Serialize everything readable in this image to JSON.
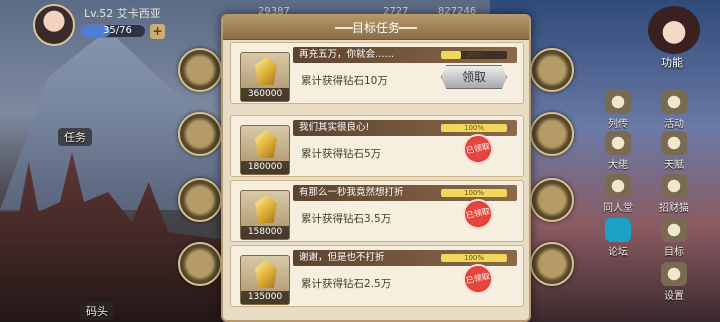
{
  "player": {
    "level": "Lv.52",
    "name": "艾卡西亚",
    "energy": "35/76",
    "energy_fraction": 0.46,
    "plus": "+"
  },
  "resources": {
    "gold": "29387",
    "diamond": "2727",
    "coin": "827246"
  },
  "left_tags": {
    "task": "任务",
    "port": "码头"
  },
  "right_menu": {
    "function": "功能",
    "items": [
      {
        "label": "列传",
        "icon": "book-icon"
      },
      {
        "label": "活动",
        "icon": "event-icon"
      },
      {
        "label": "大佬",
        "icon": "boss-icon"
      },
      {
        "label": "天赋",
        "icon": "talent-icon"
      },
      {
        "label": "同人堂",
        "icon": "hall-icon"
      },
      {
        "label": "招财猫",
        "icon": "lucky-cat-icon"
      },
      {
        "label": "论坛",
        "icon": "tap-forum-icon"
      },
      {
        "label": "目标",
        "icon": "target-icon"
      },
      {
        "label": "设置",
        "icon": "settings-icon"
      }
    ]
  },
  "dialog": {
    "title": "目标任务",
    "tasks": [
      {
        "name": "再充五万，你就会……",
        "progress_text": "30%",
        "progress": 0.3,
        "reward": "360000",
        "desc": "累计获得钻石10万",
        "status": "claim",
        "button": "领取"
      },
      {
        "name": "我们其实很良心!",
        "progress_text": "100%",
        "progress": 1.0,
        "reward": "180000",
        "desc": "累计获得钻石5万",
        "status": "claimed",
        "stamp": "已领取"
      },
      {
        "name": "有那么一秒我竟然想打折",
        "progress_text": "100%",
        "progress": 1.0,
        "reward": "158000",
        "desc": "累计获得钻石3.5万",
        "status": "claimed",
        "stamp": "已领取"
      },
      {
        "name": "谢谢，但是也不打折",
        "progress_text": "100%",
        "progress": 1.0,
        "reward": "135000",
        "desc": "累计获得钻石2.5万",
        "status": "claimed",
        "stamp": "已领取"
      }
    ]
  }
}
